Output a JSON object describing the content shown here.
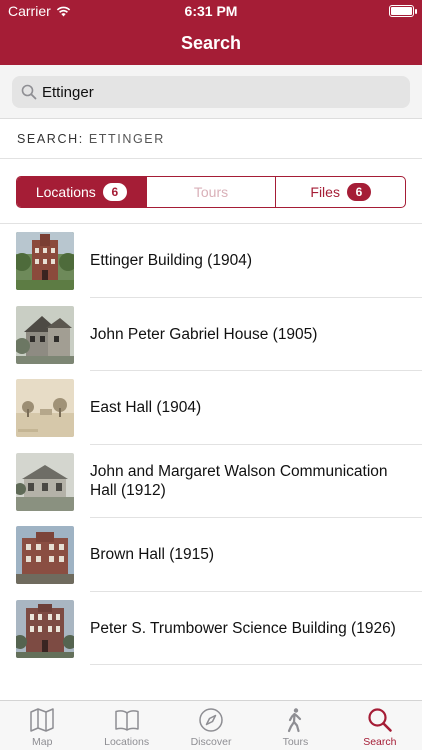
{
  "status_bar": {
    "carrier": "Carrier",
    "time": "6:31 PM"
  },
  "nav": {
    "title": "Search"
  },
  "search": {
    "value": "Ettinger"
  },
  "search_summary": {
    "prefix": "SEARCH:",
    "term": "ETTINGER"
  },
  "segments": [
    {
      "label": "Locations",
      "count": "6",
      "state": "active"
    },
    {
      "label": "Tours",
      "count": "",
      "state": "disabled"
    },
    {
      "label": "Files",
      "count": "6",
      "state": "normal"
    }
  ],
  "results": [
    {
      "title": "Ettinger Building (1904)",
      "image": "brick-tower-photo"
    },
    {
      "title": "John Peter Gabriel House (1905)",
      "image": "house-photo"
    },
    {
      "title": "East Hall (1904)",
      "image": "sepia-field-photo"
    },
    {
      "title": "John and Margaret Walson Communication Hall (1912)",
      "image": "hall-photo"
    },
    {
      "title": "Brown Hall (1915)",
      "image": "brick-hall-photo"
    },
    {
      "title": "Peter S. Trumbower Science Building (1926)",
      "image": "science-building-photo"
    }
  ],
  "tabbar": {
    "items": [
      {
        "label": "Map",
        "icon": "map-icon"
      },
      {
        "label": "Locations",
        "icon": "book-icon"
      },
      {
        "label": "Discover",
        "icon": "compass-icon"
      },
      {
        "label": "Tours",
        "icon": "walking-icon"
      },
      {
        "label": "Search",
        "icon": "search-icon"
      }
    ],
    "active": "Search"
  },
  "colors": {
    "brand": "#a51d36",
    "tab_inactive": "#8e8e93"
  }
}
